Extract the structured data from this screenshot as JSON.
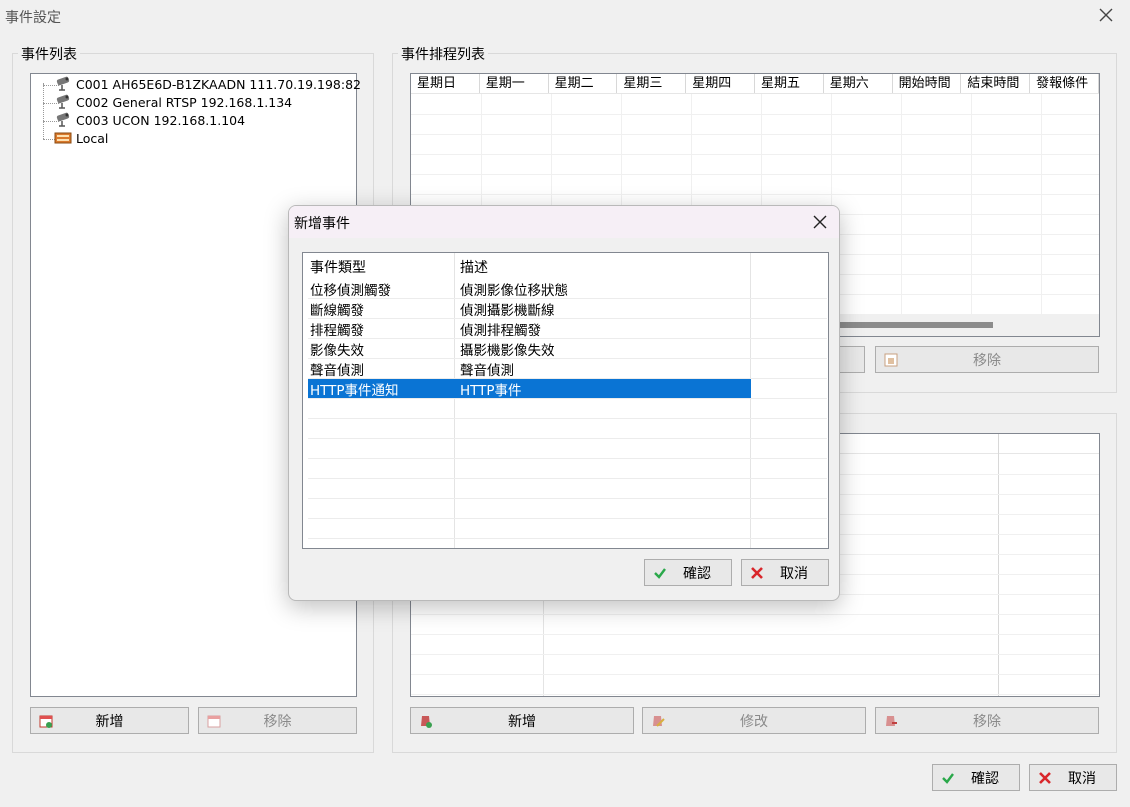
{
  "window": {
    "title": "事件設定"
  },
  "event_list": {
    "label": "事件列表",
    "items": [
      {
        "label": "C001 AH65E6D-B1ZKAADN 111.70.19.198:82",
        "icon": "camera-icon"
      },
      {
        "label": "C002 General RTSP 192.168.1.134",
        "icon": "camera-icon"
      },
      {
        "label": "C003 UCON 192.168.1.104",
        "icon": "camera-icon"
      },
      {
        "label": "Local",
        "icon": "local-device-icon"
      }
    ],
    "add_label": "新增",
    "remove_label": "移除"
  },
  "schedule": {
    "label": "事件排程列表",
    "columns": [
      "星期日",
      "星期一",
      "星期二",
      "星期三",
      "星期四",
      "星期五",
      "星期六",
      "開始時間",
      "結束時間",
      "發報條件"
    ],
    "remove_label": "移除"
  },
  "action_panel": {
    "add_label": "新增",
    "edit_label": "修改",
    "remove_label": "移除"
  },
  "footer": {
    "ok_label": "確認",
    "cancel_label": "取消"
  },
  "dialog": {
    "title": "新增事件",
    "col_type": "事件類型",
    "col_desc": "描述",
    "rows": [
      {
        "type": "位移偵測觸發",
        "desc": "偵測影像位移狀態"
      },
      {
        "type": "斷線觸發",
        "desc": "偵測攝影機斷線"
      },
      {
        "type": "排程觸發",
        "desc": "偵測排程觸發"
      },
      {
        "type": "影像失效",
        "desc": "攝影機影像失效"
      },
      {
        "type": "聲音偵測",
        "desc": "聲音偵測"
      },
      {
        "type": "HTTP事件通知",
        "desc": "HTTP事件"
      }
    ],
    "selected_index": 5,
    "ok_label": "確認",
    "cancel_label": "取消"
  },
  "colors": {
    "selection": "#0a74d4",
    "ok_check": "#2aa84a",
    "cancel_x": "#d9262b"
  }
}
